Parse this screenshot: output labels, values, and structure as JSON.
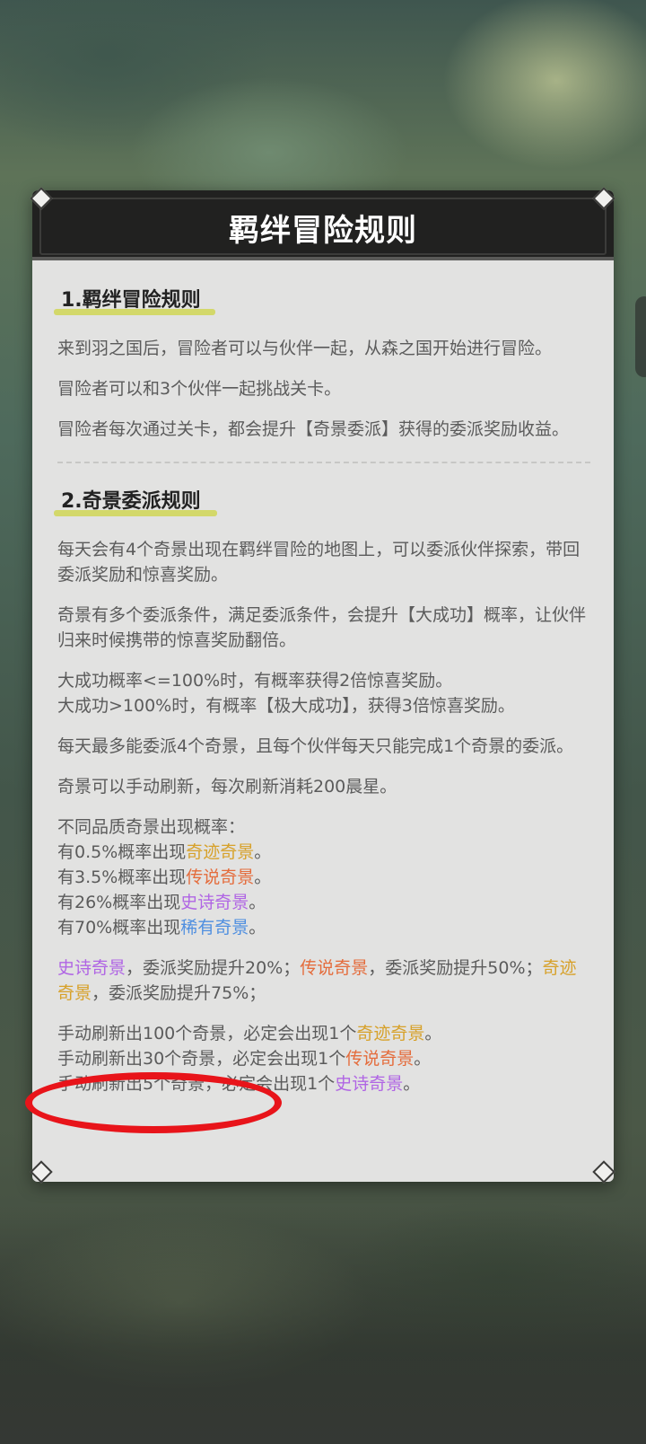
{
  "dialog": {
    "title": "羁绊冒险规则"
  },
  "section1": {
    "title": "1.羁绊冒险规则",
    "p1": "来到羽之国后，冒险者可以与伙伴一起，从森之国开始进行冒险。",
    "p2": "冒险者可以和3个伙伴一起挑战关卡。",
    "p3": "冒险者每次通过关卡，都会提升【奇景委派】获得的委派奖励收益。"
  },
  "section2": {
    "title": "2.奇景委派规则",
    "p1": "每天会有4个奇景出现在羁绊冒险的地图上，可以委派伙伴探索，带回委派奖励和惊喜奖励。",
    "p2": "奇景有多个委派条件，满足委派条件，会提升【大成功】概率，让伙伴归来时候携带的惊喜奖励翻倍。",
    "p3_line1": "大成功概率<=100%时，有概率获得2倍惊喜奖励。",
    "p3_line2": "大成功>100%时，有概率【极大成功】，获得3倍惊喜奖励。",
    "p4": "每天最多能委派4个奇景，且每个伙伴每天只能完成1个奇景的委派。",
    "p5": "奇景可以手动刷新，每次刷新消耗200晨星。",
    "quality": {
      "heading": "不同品质奇景出现概率：",
      "l1_pre": "有0.5%概率出现",
      "l1_tag": "奇迹奇景",
      "l2_pre": "有3.5%概率出现",
      "l2_tag": "传说奇景",
      "l3_pre": "有26%概率出现",
      "l3_tag": "史诗奇景",
      "l4_pre": "有70%概率出现",
      "l4_tag": "稀有奇景",
      "end": "。"
    },
    "bonus": {
      "a_tag": "史诗奇景",
      "a_text": "，委派奖励提升20%；",
      "b_tag": "传说奇景",
      "b_text": "，委派奖励提升50%；",
      "c_tag": "奇迹奇景",
      "c_text": "，委派奖励提升75%；"
    },
    "guarantee": {
      "l1_pre": "手动刷新出100个奇景，必定会出现1个",
      "l1_tag": "奇迹奇景",
      "l2_pre": "手动刷新出30个奇景，必定会出现1个",
      "l2_tag": "传说奇景",
      "l3_pre": "手动刷新出5个奇景，必定会出现1个",
      "l3_tag": "史诗奇景",
      "end": "。"
    }
  },
  "colors": {
    "miracle": "#d7a12a",
    "legend": "#e46c3c",
    "epic": "#b065e4",
    "rare": "#4f8fe0",
    "annotation": "#e8141a"
  }
}
